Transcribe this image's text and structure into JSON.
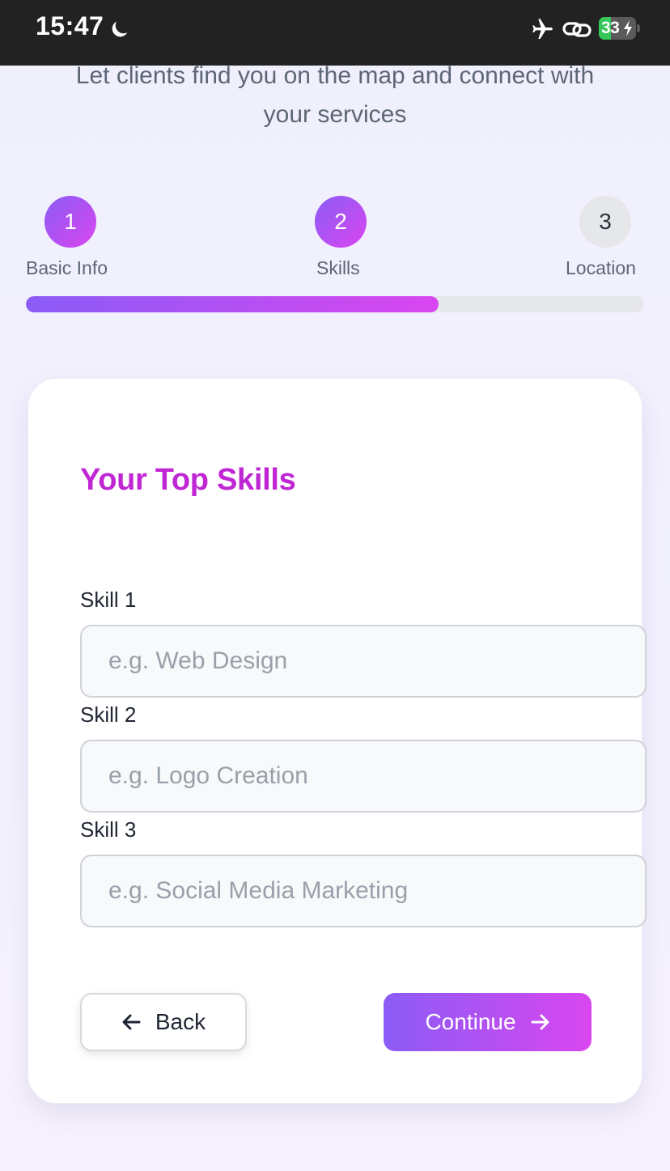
{
  "status_bar": {
    "time": "15:47",
    "battery": "33",
    "battery_level": 0.33,
    "icons": [
      "moon-icon",
      "airplane-icon",
      "link-icon",
      "battery-icon",
      "charging-bolt-icon"
    ]
  },
  "intro": {
    "subtitle_line1": "Let clients find you on the map and connect with",
    "subtitle_line2": "your services"
  },
  "stepper": {
    "steps": [
      {
        "number": "1",
        "label": "Basic Info",
        "state": "complete"
      },
      {
        "number": "2",
        "label": "Skills",
        "state": "current"
      },
      {
        "number": "3",
        "label": "Location",
        "state": "upcoming"
      }
    ],
    "progress_percent": 66.7
  },
  "card": {
    "title": "Your Top Skills",
    "fields": [
      {
        "label": "Skill 1",
        "value": "",
        "placeholder": "e.g. Web Design"
      },
      {
        "label": "Skill 2",
        "value": "",
        "placeholder": "e.g. Logo Creation"
      },
      {
        "label": "Skill 3",
        "value": "",
        "placeholder": "e.g. Social Media Marketing"
      }
    ],
    "back_label": "Back",
    "continue_label": "Continue"
  },
  "colors": {
    "accent_start": "#8b5cf6",
    "accent_end": "#d946ef",
    "title": "#c026d3"
  }
}
